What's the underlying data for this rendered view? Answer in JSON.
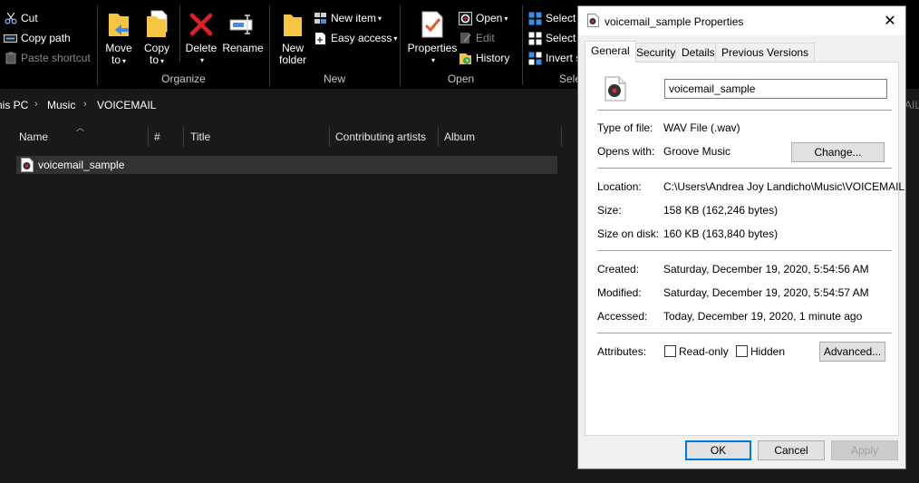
{
  "ribbon": {
    "clipboard": {
      "cut_label": "Cut",
      "copy_path_label": "Copy path",
      "paste_shortcut_label": "Paste shortcut"
    },
    "organize": {
      "group_label": "Organize",
      "move_to_label_1": "Move",
      "move_to_label_2": "to",
      "copy_to_label_1": "Copy",
      "copy_to_label_2": "to",
      "delete_label": "Delete",
      "rename_label": "Rename"
    },
    "new": {
      "group_label": "New",
      "new_folder_label_1": "New",
      "new_folder_label_2": "folder",
      "new_item_label": "New item",
      "easy_access_label": "Easy access"
    },
    "open": {
      "group_label": "Open",
      "properties_label": "Properties",
      "open_label": "Open",
      "edit_label": "Edit",
      "history_label": "History"
    },
    "select": {
      "group_label": "Sele",
      "select_all_label": "Select a",
      "select_none_label": "Select n",
      "invert_label": "Invert s"
    }
  },
  "address": {
    "crumbs": [
      "nis PC",
      "Music",
      "VOICEMAIL"
    ],
    "right_fragment": "AIL"
  },
  "filelist": {
    "columns": [
      "Name",
      "#",
      "Title",
      "Contributing artists",
      "Album"
    ],
    "files": [
      {
        "name": "voicemail_sample",
        "icon": "audio-file-icon"
      }
    ]
  },
  "dialog": {
    "title": "voicemail_sample Properties",
    "tabs": [
      "General",
      "Security",
      "Details",
      "Previous Versions"
    ],
    "active_tab": "General",
    "file_name": "voicemail_sample",
    "type_label": "Type of file:",
    "type_value": "WAV File (.wav)",
    "opens_label": "Opens with:",
    "opens_value": "Groove Music",
    "change_button": "Change...",
    "location_label": "Location:",
    "location_value": "C:\\Users\\Andrea Joy Landicho\\Music\\VOICEMAIL",
    "size_label": "Size:",
    "size_value": "158 KB (162,246 bytes)",
    "size_disk_label": "Size on disk:",
    "size_disk_value": "160 KB (163,840 bytes)",
    "created_label": "Created:",
    "created_value": "Saturday, December 19, 2020, 5:54:56 AM",
    "modified_label": "Modified:",
    "modified_value": "Saturday, December 19, 2020, 5:54:57 AM",
    "accessed_label": "Accessed:",
    "accessed_value": "Today, December 19, 2020, 1 minute ago",
    "attributes_label": "Attributes:",
    "readonly_label": "Read-only",
    "readonly_checked": false,
    "hidden_label": "Hidden",
    "hidden_checked": false,
    "advanced_button": "Advanced...",
    "ok_button": "OK",
    "cancel_button": "Cancel",
    "apply_button": "Apply"
  },
  "colors": {
    "explorer_bg": "#191919",
    "ribbon_bg": "#000000",
    "dialog_bg": "#f0f0f0",
    "accent": "#0078d7",
    "selected_row": "#323232"
  }
}
